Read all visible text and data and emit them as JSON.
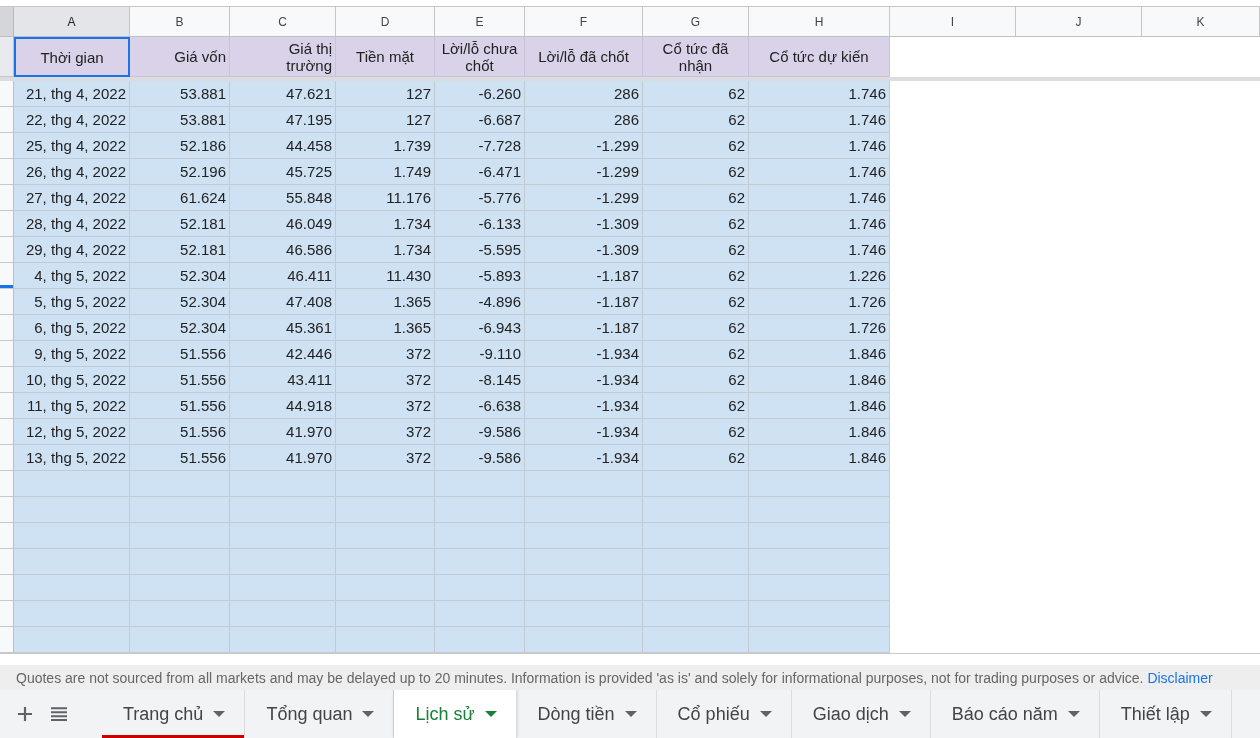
{
  "column_headers": [
    {
      "label": "A",
      "selected": true
    },
    {
      "label": "B",
      "selected": false
    },
    {
      "label": "C",
      "selected": false
    },
    {
      "label": "D",
      "selected": false
    },
    {
      "label": "E",
      "selected": false
    },
    {
      "label": "F",
      "selected": false
    },
    {
      "label": "G",
      "selected": false
    },
    {
      "label": "H",
      "selected": false
    },
    {
      "label": "I",
      "selected": false
    },
    {
      "label": "J",
      "selected": false
    },
    {
      "label": "K",
      "selected": false
    }
  ],
  "table": {
    "columns": [
      {
        "label": "Thời gian",
        "selected": true
      },
      {
        "label": "Giá vốn",
        "selected": false
      },
      {
        "label": "Giá thị trường",
        "selected": false
      },
      {
        "label": "Tiền mặt",
        "selected": false
      },
      {
        "label": "Lời/lỗ chưa chốt",
        "selected": false
      },
      {
        "label": "Lời/lỗ đã chốt",
        "selected": false
      },
      {
        "label": "Cổ tức đã nhận",
        "selected": false
      },
      {
        "label": "Cổ tức dự kiến",
        "selected": false
      }
    ],
    "rows": [
      {
        "cells": [
          "21, thg 4, 2022",
          "53.881",
          "47.621",
          "127",
          "-6.260",
          "286",
          "62",
          "1.746"
        ],
        "marker": false
      },
      {
        "cells": [
          "22, thg 4, 2022",
          "53.881",
          "47.195",
          "127",
          "-6.687",
          "286",
          "62",
          "1.746"
        ],
        "marker": false
      },
      {
        "cells": [
          "25, thg 4, 2022",
          "52.186",
          "44.458",
          "1.739",
          "-7.728",
          "-1.299",
          "62",
          "1.746"
        ],
        "marker": false
      },
      {
        "cells": [
          "26, thg 4, 2022",
          "52.196",
          "45.725",
          "1.749",
          "-6.471",
          "-1.299",
          "62",
          "1.746"
        ],
        "marker": false
      },
      {
        "cells": [
          "27, thg 4, 2022",
          "61.624",
          "55.848",
          "11.176",
          "-5.776",
          "-1.299",
          "62",
          "1.746"
        ],
        "marker": false
      },
      {
        "cells": [
          "28, thg 4, 2022",
          "52.181",
          "46.049",
          "1.734",
          "-6.133",
          "-1.309",
          "62",
          "1.746"
        ],
        "marker": false
      },
      {
        "cells": [
          "29, thg 4, 2022",
          "52.181",
          "46.586",
          "1.734",
          "-5.595",
          "-1.309",
          "62",
          "1.746"
        ],
        "marker": false
      },
      {
        "cells": [
          "4, thg 5, 2022",
          "52.304",
          "46.411",
          "11.430",
          "-5.893",
          "-1.187",
          "62",
          "1.226"
        ],
        "marker": true
      },
      {
        "cells": [
          "5, thg 5, 2022",
          "52.304",
          "47.408",
          "1.365",
          "-4.896",
          "-1.187",
          "62",
          "1.726"
        ],
        "marker": false
      },
      {
        "cells": [
          "6, thg 5, 2022",
          "52.304",
          "45.361",
          "1.365",
          "-6.943",
          "-1.187",
          "62",
          "1.726"
        ],
        "marker": false
      },
      {
        "cells": [
          "9, thg 5, 2022",
          "51.556",
          "42.446",
          "372",
          "-9.110",
          "-1.934",
          "62",
          "1.846"
        ],
        "marker": false
      },
      {
        "cells": [
          "10, thg 5, 2022",
          "51.556",
          "43.411",
          "372",
          "-8.145",
          "-1.934",
          "62",
          "1.846"
        ],
        "marker": false
      },
      {
        "cells": [
          "11, thg 5, 2022",
          "51.556",
          "44.918",
          "372",
          "-6.638",
          "-1.934",
          "62",
          "1.846"
        ],
        "marker": false
      },
      {
        "cells": [
          "12, thg 5, 2022",
          "51.556",
          "41.970",
          "372",
          "-9.586",
          "-1.934",
          "62",
          "1.846"
        ],
        "marker": false
      },
      {
        "cells": [
          "13, thg 5, 2022",
          "51.556",
          "41.970",
          "372",
          "-9.586",
          "-1.934",
          "62",
          "1.846"
        ],
        "marker": false
      }
    ]
  },
  "status_bar": {
    "notice": "Quotes are not sourced from all markets and may be delayed up to 20 minutes. Information is provided 'as is' and solely for informational purposes, not for trading purposes or advice.",
    "link": "Disclaimer"
  },
  "sheet_tabs": [
    {
      "label": "Trang chủ",
      "selected": false,
      "color": "#cc0000"
    },
    {
      "label": "Tổng quan",
      "selected": false
    },
    {
      "label": "Lịch sử",
      "selected": true
    },
    {
      "label": "Dòng tiền",
      "selected": false
    },
    {
      "label": "Cổ phiếu",
      "selected": false
    },
    {
      "label": "Giao dịch",
      "selected": false
    },
    {
      "label": "Báo cáo năm",
      "selected": false
    },
    {
      "label": "Thiết lập",
      "selected": false
    }
  ]
}
